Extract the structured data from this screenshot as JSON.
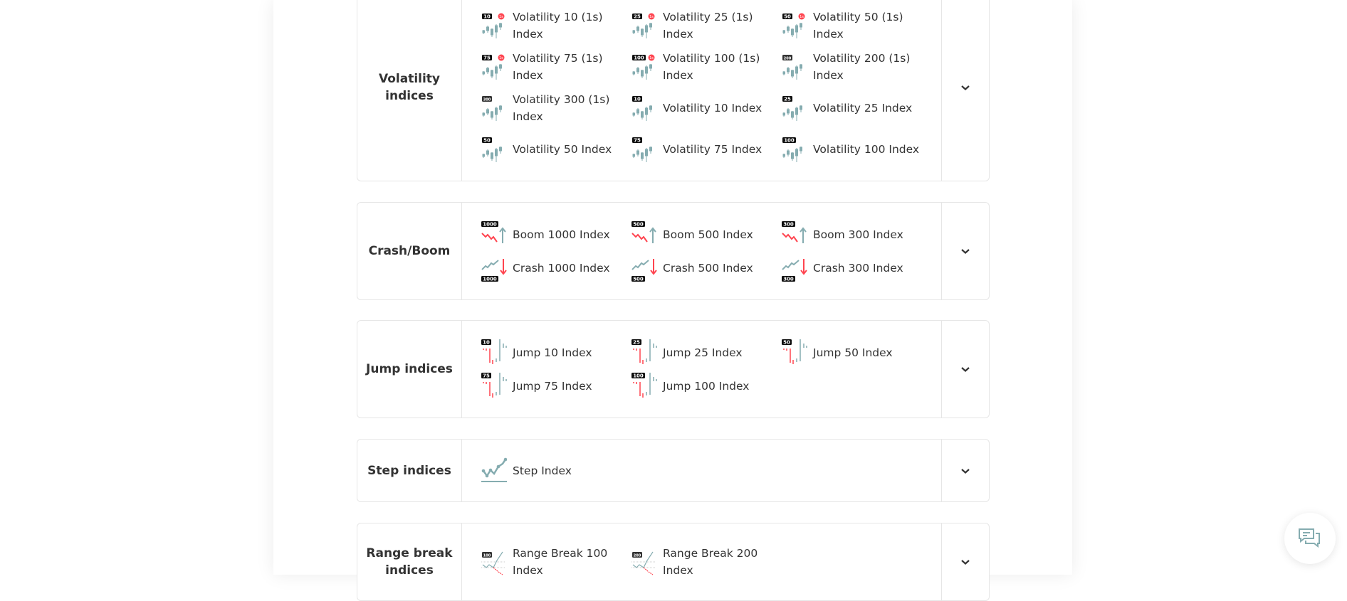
{
  "colors": {
    "accent_teal": "#85acb0",
    "accent_red": "#ff444f",
    "badge": "#0e0e0e",
    "text": "#333333",
    "border": "#e6e6e6"
  },
  "categories": [
    {
      "label": "Volatility indices",
      "icon": "volatility",
      "expand_icon": "chevron-down-icon",
      "items": [
        {
          "label": "Volatility 10 (1s) Index",
          "badge": "10",
          "one_second": true
        },
        {
          "label": "Volatility 25 (1s) Index",
          "badge": "25",
          "one_second": true
        },
        {
          "label": "Volatility 50 (1s) Index",
          "badge": "50",
          "one_second": true
        },
        {
          "label": "Volatility 75 (1s) Index",
          "badge": "75",
          "one_second": true
        },
        {
          "label": "Volatility 100 (1s) Index",
          "badge": "100",
          "one_second": true
        },
        {
          "label": "Volatility 200 (1s) Index",
          "badge": "200",
          "one_second": false
        },
        {
          "label": "Volatility 300 (1s) Index",
          "badge": "300",
          "one_second": false
        },
        {
          "label": "Volatility 10 Index",
          "badge": "10",
          "one_second": false
        },
        {
          "label": "Volatility 25 Index",
          "badge": "25",
          "one_second": false
        },
        {
          "label": "Volatility 50 Index",
          "badge": "50",
          "one_second": false
        },
        {
          "label": "Volatility 75 Index",
          "badge": "75",
          "one_second": false
        },
        {
          "label": "Volatility 100 Index",
          "badge": "100",
          "one_second": false
        }
      ]
    },
    {
      "label": "Crash/Boom",
      "icon": "crashboom",
      "expand_icon": "chevron-down-icon",
      "items": [
        {
          "label": "Boom 1000 Index",
          "badge": "1000",
          "kind": "boom"
        },
        {
          "label": "Boom 500 Index",
          "badge": "500",
          "kind": "boom"
        },
        {
          "label": "Boom 300 Index",
          "badge": "300",
          "kind": "boom"
        },
        {
          "label": "Crash 1000 Index",
          "badge": "1000",
          "kind": "crash"
        },
        {
          "label": "Crash 500 Index",
          "badge": "500",
          "kind": "crash"
        },
        {
          "label": "Crash 300 Index",
          "badge": "300",
          "kind": "crash"
        }
      ]
    },
    {
      "label": "Jump indices",
      "icon": "jump",
      "expand_icon": "chevron-down-icon",
      "items": [
        {
          "label": "Jump 10 Index",
          "badge": "10"
        },
        {
          "label": "Jump 25 Index",
          "badge": "25"
        },
        {
          "label": "Jump 50 Index",
          "badge": "50"
        },
        {
          "label": "Jump 75 Index",
          "badge": "75"
        },
        {
          "label": "Jump 100 Index",
          "badge": "100"
        }
      ]
    },
    {
      "label": "Step indices",
      "icon": "step",
      "expand_icon": "chevron-down-icon",
      "items": [
        {
          "label": "Step Index",
          "badge": ""
        }
      ]
    },
    {
      "label": "Range break indices",
      "icon": "range",
      "expand_icon": "chevron-down-icon",
      "items": [
        {
          "label": "Range Break 100 Index",
          "badge": "100"
        },
        {
          "label": "Range Break 200 Index",
          "badge": "200"
        }
      ]
    }
  ],
  "chat": {
    "icon": "chat-bubbles-icon"
  }
}
